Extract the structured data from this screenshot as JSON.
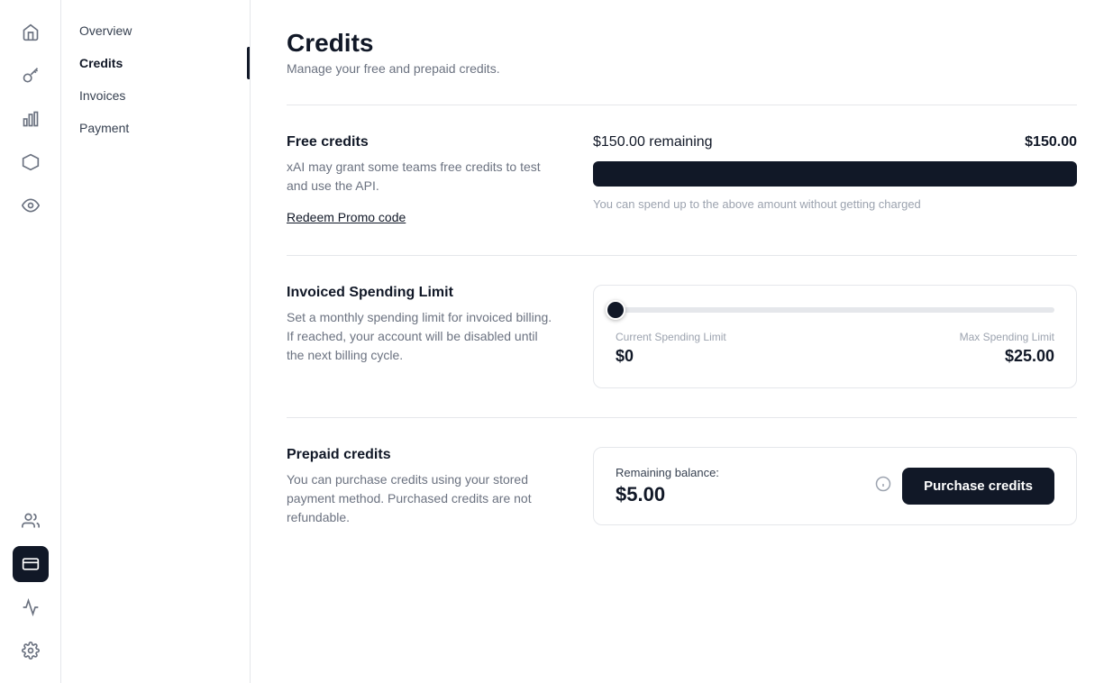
{
  "sidebar": {
    "icons": [
      {
        "name": "home-icon",
        "symbol": "⌂",
        "active": false
      },
      {
        "name": "key-icon",
        "symbol": "🔑",
        "active": false
      },
      {
        "name": "chart-icon",
        "symbol": "📊",
        "active": false
      },
      {
        "name": "hexagon-icon",
        "symbol": "⬡",
        "active": false
      },
      {
        "name": "eye-icon",
        "symbol": "◎",
        "active": false
      }
    ],
    "bottom_icons": [
      {
        "name": "users-icon",
        "symbol": "👥",
        "active": false
      },
      {
        "name": "billing-icon",
        "symbol": "▣",
        "active": true
      },
      {
        "name": "activity-icon",
        "symbol": "⌇",
        "active": false
      },
      {
        "name": "settings-icon",
        "symbol": "⚙",
        "active": false
      }
    ]
  },
  "nav": {
    "items": [
      {
        "label": "Overview",
        "active": false
      },
      {
        "label": "Credits",
        "active": true
      },
      {
        "label": "Invoices",
        "active": false
      },
      {
        "label": "Payment",
        "active": false
      }
    ]
  },
  "page": {
    "title": "Credits",
    "subtitle": "Manage your free and prepaid credits."
  },
  "free_credits": {
    "title": "Free credits",
    "description": "xAI may grant some teams free credits to test and use the API.",
    "redeem_label": "Redeem Promo code",
    "remaining_label": "$150.00 remaining",
    "amount_label": "$150.00",
    "progress_percent": 100,
    "note": "You can spend up to the above amount without getting charged"
  },
  "invoiced_spending": {
    "title": "Invoiced Spending Limit",
    "description": "Set a monthly spending limit for invoiced billing. If reached, your account will be disabled until the next billing cycle.",
    "current_label": "Current Spending Limit",
    "max_label": "Max Spending Limit",
    "current_value": "$0",
    "max_value": "$25.00",
    "slider_percent": 0
  },
  "prepaid_credits": {
    "title": "Prepaid credits",
    "description": "You can purchase credits using your stored payment method. Purchased credits are not refundable.",
    "balance_label": "Remaining balance:",
    "balance_amount": "$5.00",
    "purchase_btn_label": "Purchase credits"
  }
}
